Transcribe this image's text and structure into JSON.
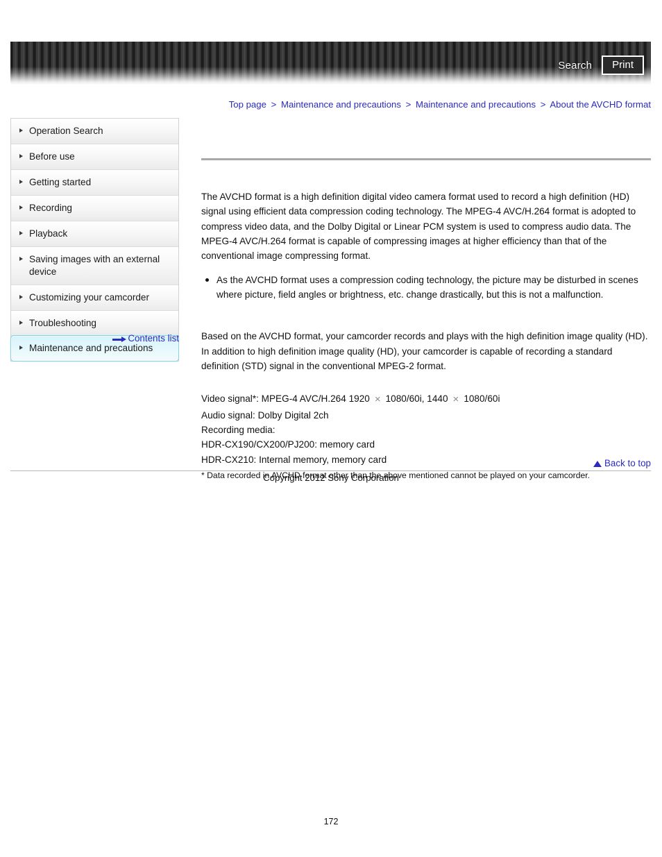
{
  "header": {
    "search_label": "Search",
    "print_label": "Print"
  },
  "breadcrumb": {
    "separator": ">",
    "items": [
      {
        "label": "Top page"
      },
      {
        "label": "Maintenance and precautions"
      },
      {
        "label": "Maintenance and precautions"
      },
      {
        "label": "About the AVCHD format"
      }
    ]
  },
  "sidebar": {
    "items": [
      {
        "label": "Operation Search",
        "active": false
      },
      {
        "label": "Before use",
        "active": false
      },
      {
        "label": "Getting started",
        "active": false
      },
      {
        "label": "Recording",
        "active": false
      },
      {
        "label": "Playback",
        "active": false
      },
      {
        "label": "Saving images with an external device",
        "active": false
      },
      {
        "label": "Customizing your camcorder",
        "active": false
      },
      {
        "label": "Troubleshooting",
        "active": false
      },
      {
        "label": "Maintenance and precautions",
        "active": true
      }
    ],
    "contents_list_label": "Contents list"
  },
  "main": {
    "intro_paragraph": "The AVCHD format is a high definition digital video camera format used to record a high definition (HD) signal using efficient data compression coding technology. The MPEG-4 AVC/H.264 format is adopted to compress video data, and the Dolby Digital or Linear PCM system is used to compress audio data. The MPEG-4 AVC/H.264 format is capable of compressing images at higher efficiency than that of the conventional image compressing format.",
    "bullets": [
      "As the AVCHD format uses a compression coding technology, the picture may be disturbed in scenes where picture, field angles or brightness, etc. change drastically, but this is not a malfunction."
    ],
    "based_paragraph": "Based on the AVCHD format, your camcorder records and plays with the high definition image quality (HD).\nIn addition to high definition image quality (HD), your camcorder is capable of recording a standard definition (STD) signal in the conventional MPEG-2 format.",
    "spec": {
      "video_signal_prefix": "Video signal*: MPEG-4 AVC/H.264 1920",
      "video_res_1": "1080/60i, 1440",
      "video_res_2": "1080/60i",
      "times_symbol": "×",
      "audio_signal": "Audio signal: Dolby Digital 2ch",
      "recording_media_label": "Recording media:",
      "media_line_1": "HDR-CX190/CX200/PJ200: memory card",
      "media_line_2": "HDR-CX210: Internal memory, memory card"
    },
    "footnote": "* Data recorded in AVCHD format other than the above mentioned cannot be played on your camcorder."
  },
  "footer": {
    "back_to_top_label": "Back to top",
    "copyright": "Copyright 2012 Sony Corporation",
    "page_number": "172"
  }
}
